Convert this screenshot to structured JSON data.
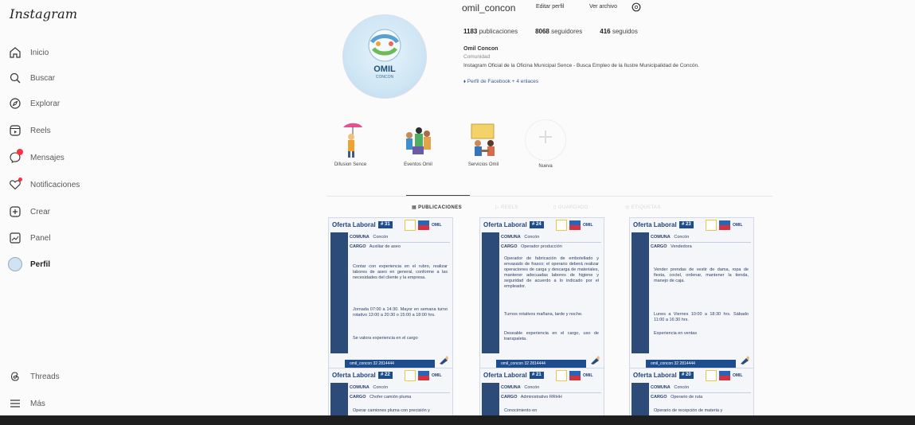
{
  "sidebar": {
    "logo": "Instagram",
    "items": [
      {
        "label": "Inicio",
        "icon": "home-icon"
      },
      {
        "label": "Buscar",
        "icon": "search-icon"
      },
      {
        "label": "Explorar",
        "icon": "compass-icon"
      },
      {
        "label": "Reels",
        "icon": "reels-icon"
      },
      {
        "label": "Mensajes",
        "icon": "messenger-icon"
      },
      {
        "label": "Notificaciones",
        "icon": "heart-icon"
      },
      {
        "label": "Crear",
        "icon": "plus-square-icon"
      },
      {
        "label": "Panel",
        "icon": "dashboard-icon"
      },
      {
        "label": "Perfil",
        "icon": "avatar"
      }
    ],
    "bottom": [
      {
        "label": "Threads",
        "icon": "threads-icon"
      },
      {
        "label": "Más",
        "icon": "menu-icon"
      }
    ]
  },
  "profile": {
    "username": "omil_concon",
    "edit_button": "Editar perfil",
    "archive_button": "Ver archivo",
    "pic_text": "OMIL",
    "pic_subtext": "CONCON",
    "stats": {
      "posts_num": "1183",
      "posts_label": "publicaciones",
      "followers_num": "8068",
      "followers_label": "seguidores",
      "following_num": "416",
      "following_label": "seguidos"
    },
    "bio_name": "Omil Concon",
    "bio_category": "Comunidad",
    "bio_text": "Instagram Oficial de la Oficina Municipal Sence - Busca Empleo de la Ilustre Municipalidad de Concón.",
    "bio_link": "Perfil de Facebook + 4 enlaces"
  },
  "highlights": [
    {
      "label": "Difusion Sence"
    },
    {
      "label": "Eventos Omil"
    },
    {
      "label": "Servicios Omil"
    },
    {
      "label": "Nueva"
    }
  ],
  "tabs": [
    {
      "label": "PUBLICACIONES",
      "active": true
    },
    {
      "label": "REELS",
      "active": false
    },
    {
      "label": "GUARDADO",
      "active": false
    },
    {
      "label": "ETIQUETAS",
      "active": false
    }
  ],
  "posts": [
    {
      "title": "Oferta Laboral",
      "number": "# 31",
      "comuna": "Concón",
      "cargo": "Auxiliar de aseo",
      "desc": "Contar con experiencia en el rubro, realizar labores de aseo en general, conforme a las necesidades del cliente y la empresa.",
      "horario": "Jornada 07:00 a 14:30. Mayor en semana turno rotativo 13:00 a 20:30 o 15:00 a 18:00 hrs.",
      "req": "Se valora experiencia en el cargo",
      "footer": "omil_concon  32 2814444"
    },
    {
      "title": "Oferta Laboral",
      "number": "# 24",
      "comuna": "Concón",
      "cargo": "Operador producción",
      "desc": "Operador de fabricación de embotellado y envasado de frasco; el operario deberá realizar operaciones de carga y descarga de materiales, mantener adecuadas labores de higiene y seguridad de acuerdo a lo indicado por el empleador.",
      "horario": "Turnos rotativos mañana, tarde y noche.",
      "req": "Deseable experiencia en el cargo, uso de transpaleta.",
      "footer": "omil_concon  32 2814444"
    },
    {
      "title": "Oferta Laboral",
      "number": "# 23",
      "comuna": "Concón",
      "cargo": "Vendedora",
      "desc": "Vender prendas de vestir de dama, ropa de fiesta, coctel, ordenar, mantener la tienda, manejo de caja.",
      "horario": "Lunes a Viernes 10:00 a 18:30 hrs. Sábado 11:00 a 16:30 hrs.",
      "req": "Experiencia en ventas",
      "footer": "omil_concon  32 2814444"
    },
    {
      "title": "Oferta Laboral",
      "number": "# 22",
      "comuna": "Concón",
      "cargo": "Chofer camión pluma",
      "desc": "Operar camiones pluma con precisión y",
      "horario": "",
      "req": "",
      "footer": ""
    },
    {
      "title": "Oferta Laboral",
      "number": "# 21",
      "comuna": "Concón",
      "cargo": "Administrativo RRHH",
      "desc": "Conocimiento en",
      "horario": "",
      "req": "",
      "footer": ""
    },
    {
      "title": "Oferta Laboral",
      "number": "# 20",
      "comuna": "Concón",
      "cargo": "Operario de ruta",
      "desc": "Operario de recepción de materia y",
      "horario": "",
      "req": "",
      "footer": ""
    }
  ],
  "row_labels": {
    "comuna": "COMUNA",
    "cargo": "CARGO"
  },
  "colors": {
    "accent": "#1d4d8c",
    "notification": "#ff3040"
  }
}
